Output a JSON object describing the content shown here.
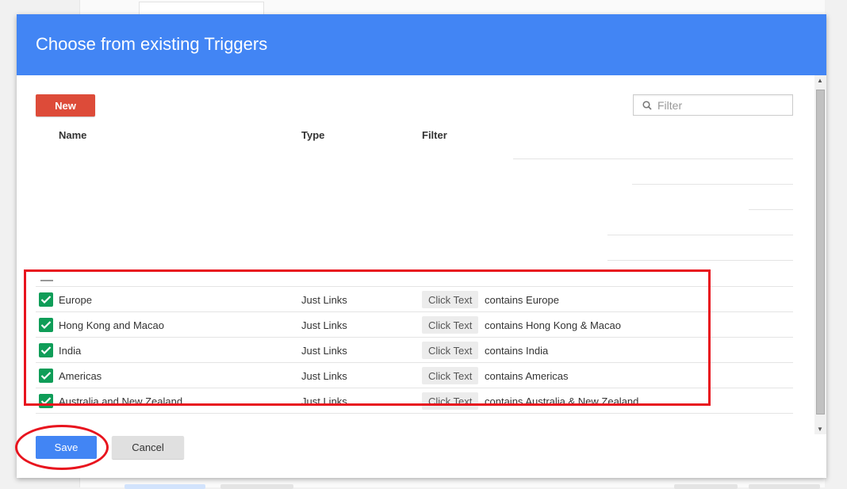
{
  "dialog": {
    "title": "Choose from existing Triggers"
  },
  "toolbar": {
    "new_label": "New",
    "filter_placeholder": "Filter"
  },
  "table": {
    "headers": [
      "Name",
      "Type",
      "Filter"
    ],
    "rows": [
      {
        "name": "Europe",
        "type": "Just Links",
        "chip": "Click Text",
        "filter": "contains Europe",
        "checked": true
      },
      {
        "name": "Hong Kong and Macao",
        "type": "Just Links",
        "chip": "Click Text",
        "filter": "contains Hong Kong & Macao",
        "checked": true
      },
      {
        "name": "India",
        "type": "Just Links",
        "chip": "Click Text",
        "filter": "contains India",
        "checked": true
      },
      {
        "name": "Americas",
        "type": "Just Links",
        "chip": "Click Text",
        "filter": "contains Americas",
        "checked": true
      },
      {
        "name": "Australia and New Zealand",
        "type": "Just Links",
        "chip": "Click Text",
        "filter": "contains Australia & New Zealand",
        "checked": true
      }
    ]
  },
  "footer": {
    "save_label": "Save",
    "cancel_label": "Cancel"
  },
  "colors": {
    "header": "#4285f4",
    "new_button": "#dd4b39",
    "checkbox": "#0f9d58",
    "annotation": "#e8141e"
  }
}
